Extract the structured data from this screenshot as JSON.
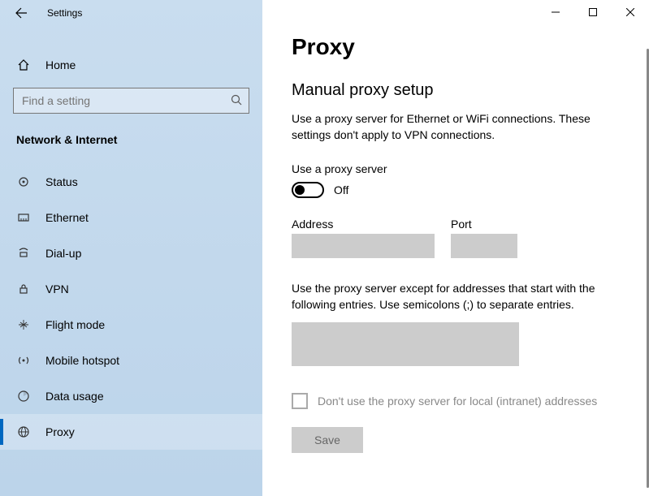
{
  "titlebar": {
    "title": "Settings"
  },
  "sidebar": {
    "home": "Home",
    "search_placeholder": "Find a setting",
    "category": "Network & Internet",
    "items": [
      {
        "label": "Status",
        "icon": "status-icon"
      },
      {
        "label": "Ethernet",
        "icon": "ethernet-icon"
      },
      {
        "label": "Dial-up",
        "icon": "dialup-icon"
      },
      {
        "label": "VPN",
        "icon": "vpn-icon"
      },
      {
        "label": "Flight mode",
        "icon": "airplane-icon"
      },
      {
        "label": "Mobile hotspot",
        "icon": "hotspot-icon"
      },
      {
        "label": "Data usage",
        "icon": "data-icon"
      },
      {
        "label": "Proxy",
        "icon": "proxy-icon"
      }
    ],
    "selected_index": 7
  },
  "main": {
    "page_title": "Proxy",
    "section_title": "Manual proxy setup",
    "description": "Use a proxy server for Ethernet or WiFi connections. These settings don't apply to VPN connections.",
    "toggle_label": "Use a proxy server",
    "toggle_state": "Off",
    "address_label": "Address",
    "address_value": "",
    "port_label": "Port",
    "port_value": "",
    "exceptions_text": "Use the proxy server except for addresses that start with the following entries. Use semicolons (;) to separate entries.",
    "exceptions_value": "",
    "local_checkbox_label": "Don't use the proxy server for local (intranet) addresses",
    "local_checked": false,
    "save_label": "Save"
  }
}
